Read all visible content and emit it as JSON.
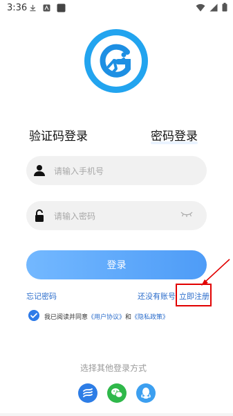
{
  "status_bar": {
    "time": "3:36"
  },
  "tabs": {
    "sms_login": "验证码登录",
    "password_login": "密码登录"
  },
  "phone_field": {
    "placeholder": "请输入手机号"
  },
  "password_field": {
    "placeholder": "请输入密码"
  },
  "login_button": {
    "label": "登录"
  },
  "links": {
    "forgot_password": "忘记密码",
    "no_account": "还没有账号",
    "register_now": "立即注册"
  },
  "agreement": {
    "prefix": "我已阅读并同意",
    "user_agreement": "《用户协议》",
    "and": "和",
    "privacy_policy": "《隐私政策》"
  },
  "other_logins": {
    "title": "选择其他登录方式"
  },
  "colors": {
    "accent": "#4e9cf7",
    "link": "#2a6ccb",
    "highlight": "#e10000",
    "wechat": "#2fb84a"
  }
}
